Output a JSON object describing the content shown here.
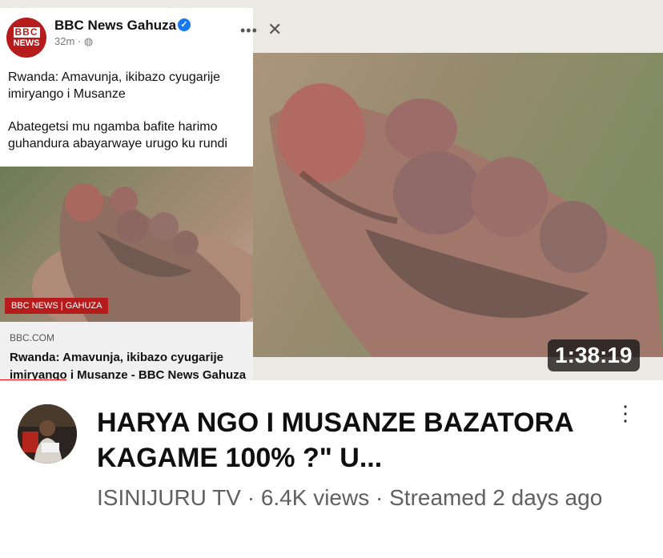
{
  "thumbnail": {
    "post": {
      "page_name": "BBC News Gahuza",
      "time": "32m ·",
      "logo_top": "BBC",
      "logo_bottom": "NEWS",
      "headline": "Rwanda: Amavunja, ikibazo cyugarije imiryango i Musanze",
      "subtext": "Abategetsi mu ngamba bafite harimo guhandura abayarwaye urugo ku rundi",
      "banner_text": "BBC NEWS | GAHUZA",
      "link_domain": "BBC.COM",
      "link_title": "Rwanda: Amavunja, ikibazo cyugarije imiryango i Musanze  - BBC News Gahuza"
    },
    "duration": "1:38:19",
    "watch_progress_fraction": 0.1
  },
  "video": {
    "title": "HARYA NGO I MUSANZE BAZATORA KAGAME 100% ?\" U...",
    "meta": "ISINIJURU TV · 6.4K views · Streamed 2 days ago"
  },
  "colors": {
    "bbc_red": "#b71c1c",
    "progress_red": "#ff0000",
    "verified_blue": "#1877f2"
  }
}
